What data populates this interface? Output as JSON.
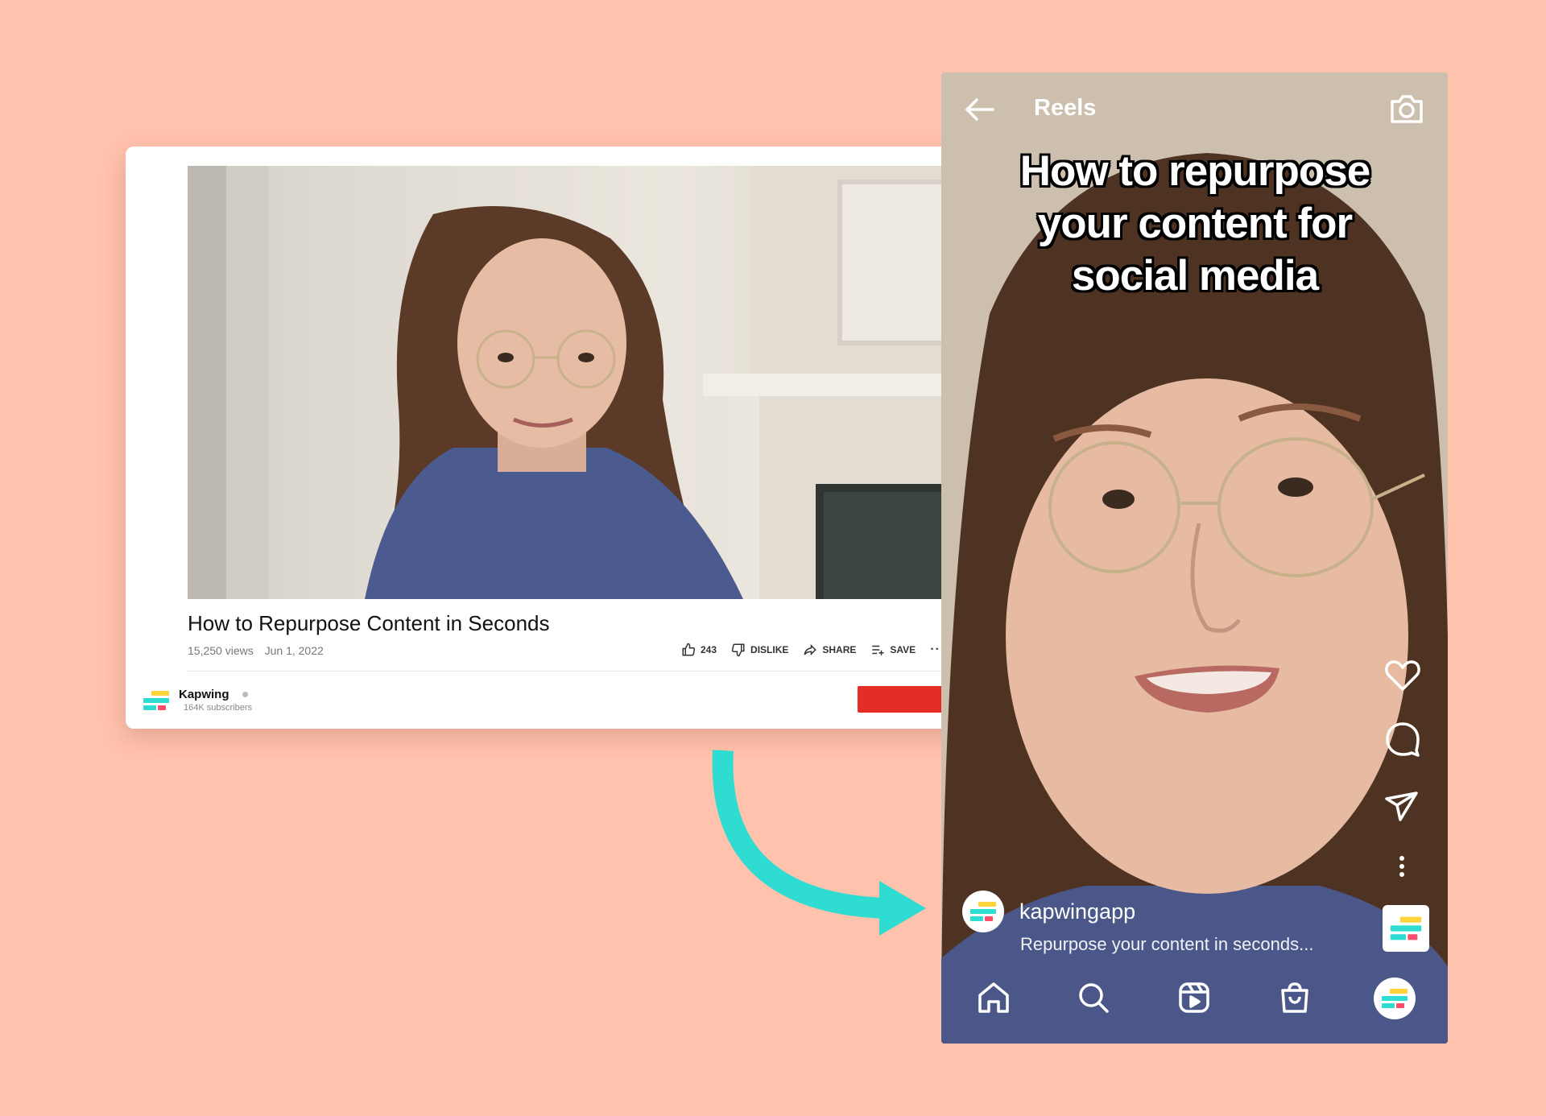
{
  "youtube": {
    "video_title": "How to Repurpose Content in Seconds",
    "views": "15,250 views",
    "date": "Jun 1, 2022",
    "like_count": "243",
    "dislike_label": "DISLIKE",
    "share_label": "SHARE",
    "save_label": "SAVE",
    "more_label": "···",
    "channel_name": "Kapwing",
    "subscribers": "164K subscribers",
    "subscribe_color": "#e52d27"
  },
  "reels": {
    "header_title": "Reels",
    "caption": "How to repurpose your content for social media",
    "username": "kapwingapp",
    "description": "Repurpose your content in seconds...",
    "icons": [
      "back-arrow-icon",
      "camera-icon",
      "heart-icon",
      "comment-icon",
      "send-icon",
      "more-vertical-icon",
      "home-icon",
      "search-icon",
      "reels-icon",
      "shop-icon"
    ]
  },
  "colors": {
    "background": "#ffc2ad",
    "arrow": "#2fdcd2",
    "logo_yellow": "#ffd43b",
    "logo_teal": "#2fdcd2",
    "logo_pink": "#ff4d6d"
  }
}
